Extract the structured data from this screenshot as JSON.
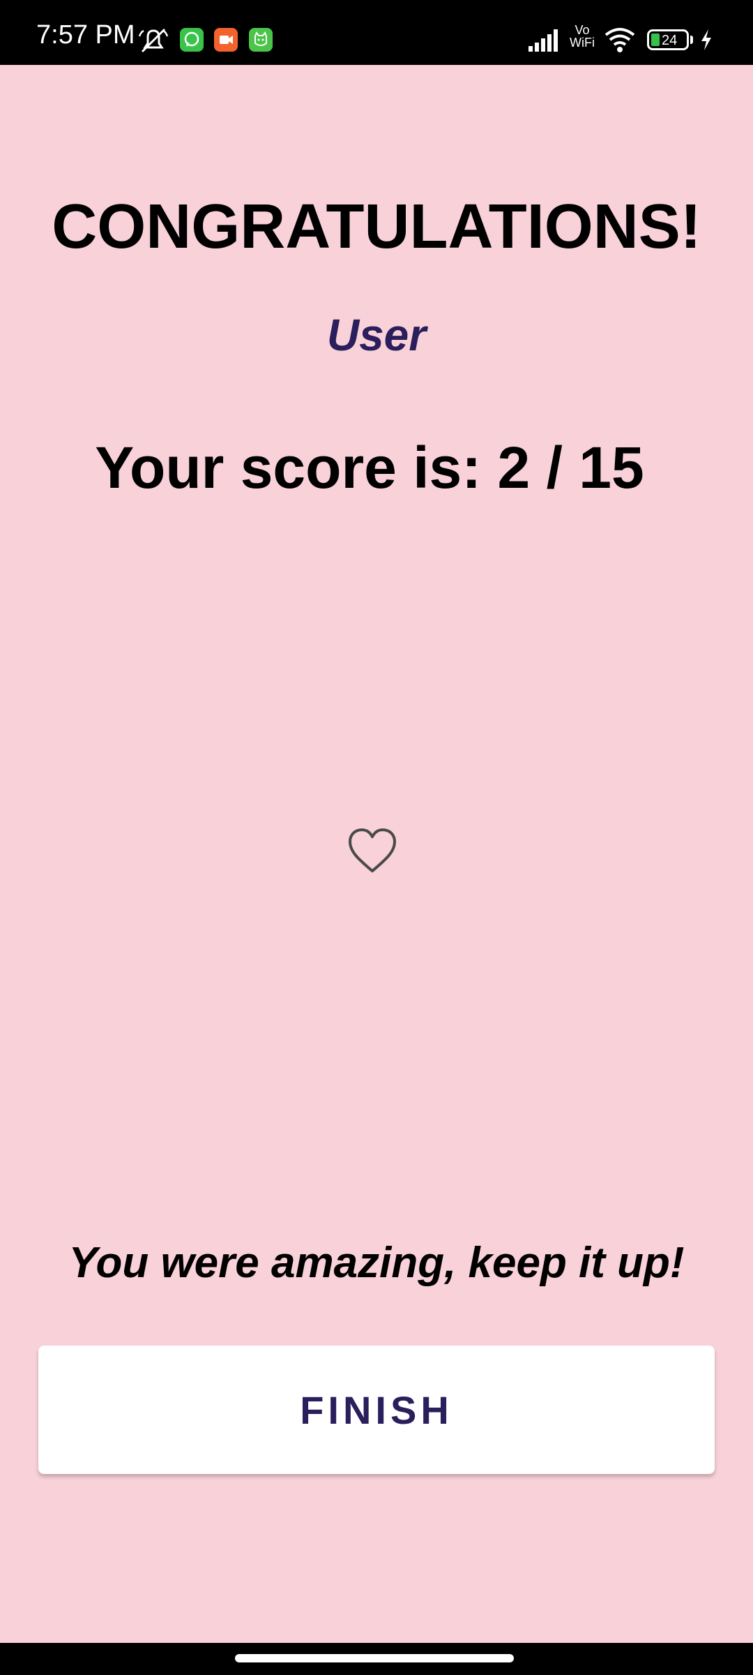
{
  "status_bar": {
    "time": "7:57 PM",
    "battery": "24",
    "vowifi_line1": "Vo",
    "vowifi_line2": "WiFi",
    "icons": [
      "mute-icon",
      "whatsapp-icon",
      "video-app-icon",
      "cat-app-icon",
      "signal-icon",
      "vowifi-icon",
      "wifi-icon",
      "battery-icon",
      "charging-icon"
    ],
    "app_icon_colors": {
      "whatsapp": "#3ac34a",
      "video": "#f4622e",
      "cat": "#4cc44a"
    }
  },
  "result": {
    "title": "CONGRATULATIONS!",
    "username": "User",
    "score_text": "Your score is: 2 / 15",
    "message": "You were amazing, keep it up!"
  },
  "actions": {
    "finish_label": "FINISH"
  },
  "illustration": {
    "icon": "heart-outline-icon"
  },
  "colors": {
    "background": "#f9d1d9",
    "accent": "#2b1e5c",
    "button_bg": "#ffffff"
  }
}
